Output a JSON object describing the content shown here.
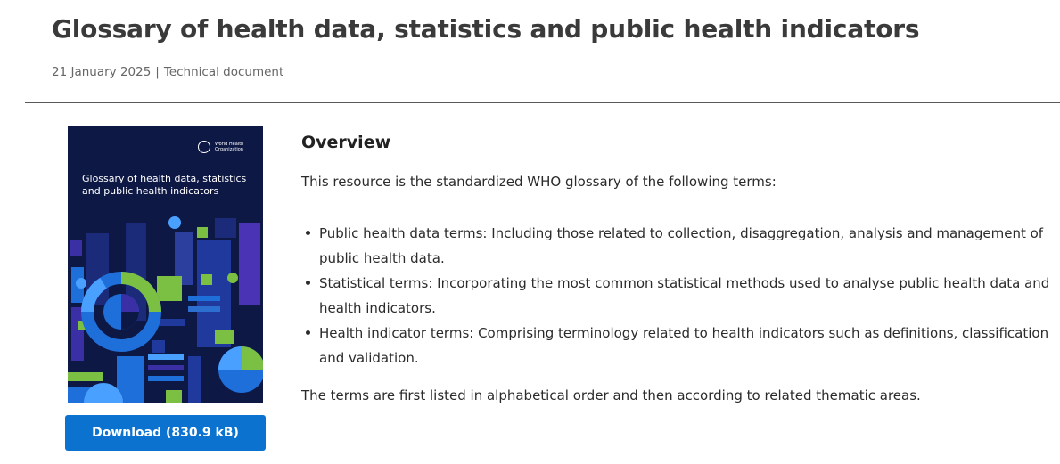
{
  "header": {
    "title": "Glossary of health data, statistics and public health indicators",
    "date": "21 January 2025",
    "separator": "|",
    "doc_type": "Technical document"
  },
  "cover": {
    "logo_text": "World Health Organization",
    "title": "Glossary of health data, statistics and public health indicators"
  },
  "overview": {
    "heading": "Overview",
    "intro": "This resource is the standardized WHO glossary of the following terms:",
    "bullets": [
      "Public health data terms: Including those related to collection, disaggregation, analysis and management of public health data.",
      "Statistical terms: Incorporating the most common statistical methods used to analyse public health data and health indicators.",
      "Health indicator terms: Comprising terminology related to health indicators such as definitions, classification and validation."
    ],
    "closing": "The terms are first listed in alphabetical order and then according to related thematic areas."
  },
  "download": {
    "label": "Download (830.9 kB)"
  },
  "colors": {
    "cover_bg": "#0d1845",
    "button_bg": "#0b72d0",
    "divider": "#5a5a5a"
  }
}
